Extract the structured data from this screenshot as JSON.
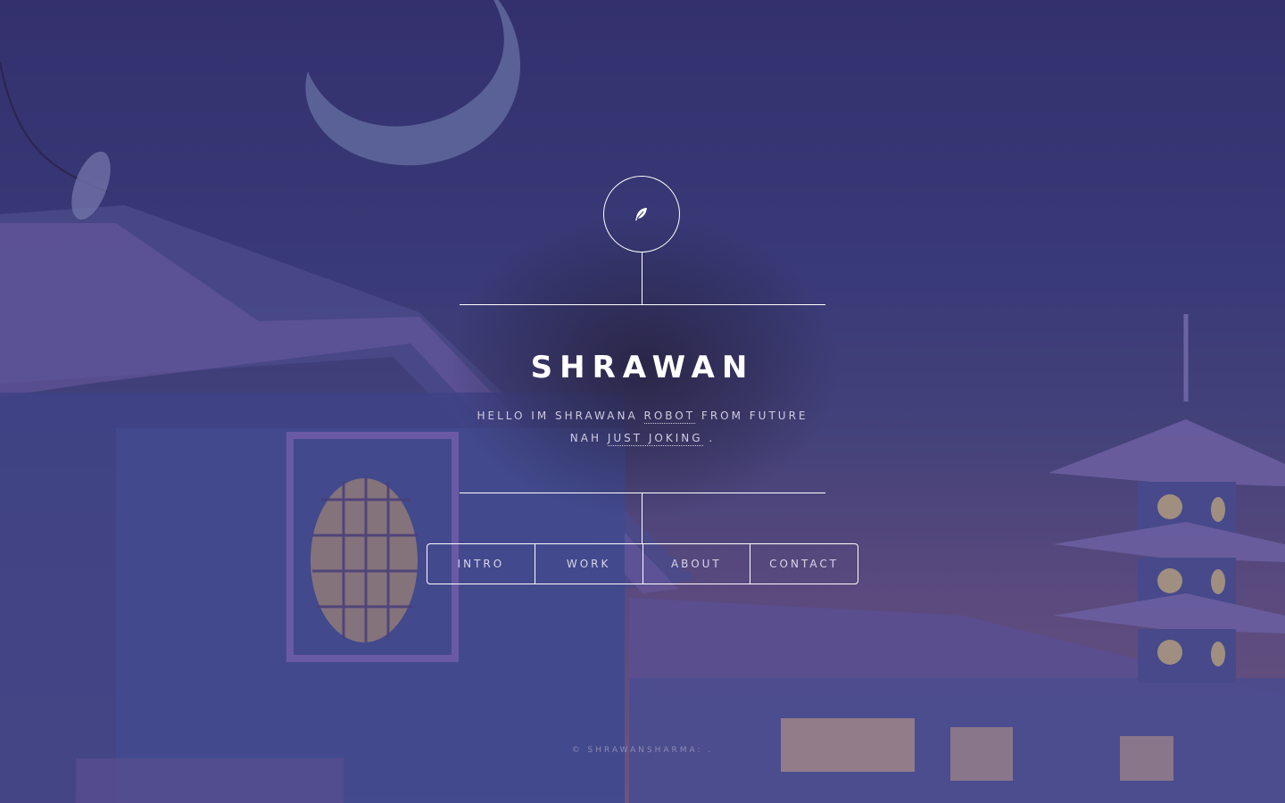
{
  "site": {
    "title": "SHRAWAN",
    "logo_icon": "feather-icon"
  },
  "tagline": {
    "line1_pre": "HELLO IM SHRAWANA",
    "line1_link": "ROBOT",
    "line1_post": "FROM FUTURE",
    "line2_pre": "NAH",
    "line2_link": "JUST JOKING",
    "line2_post": "."
  },
  "nav": {
    "items": [
      {
        "label": "INTRO"
      },
      {
        "label": "WORK"
      },
      {
        "label": "ABOUT"
      },
      {
        "label": "CONTACT"
      }
    ]
  },
  "footer": {
    "text": "© SHRAWANSHARMA: ."
  },
  "colors": {
    "line": "#ffffff",
    "sky_top": "#33306d",
    "moon": "#5d6496"
  }
}
